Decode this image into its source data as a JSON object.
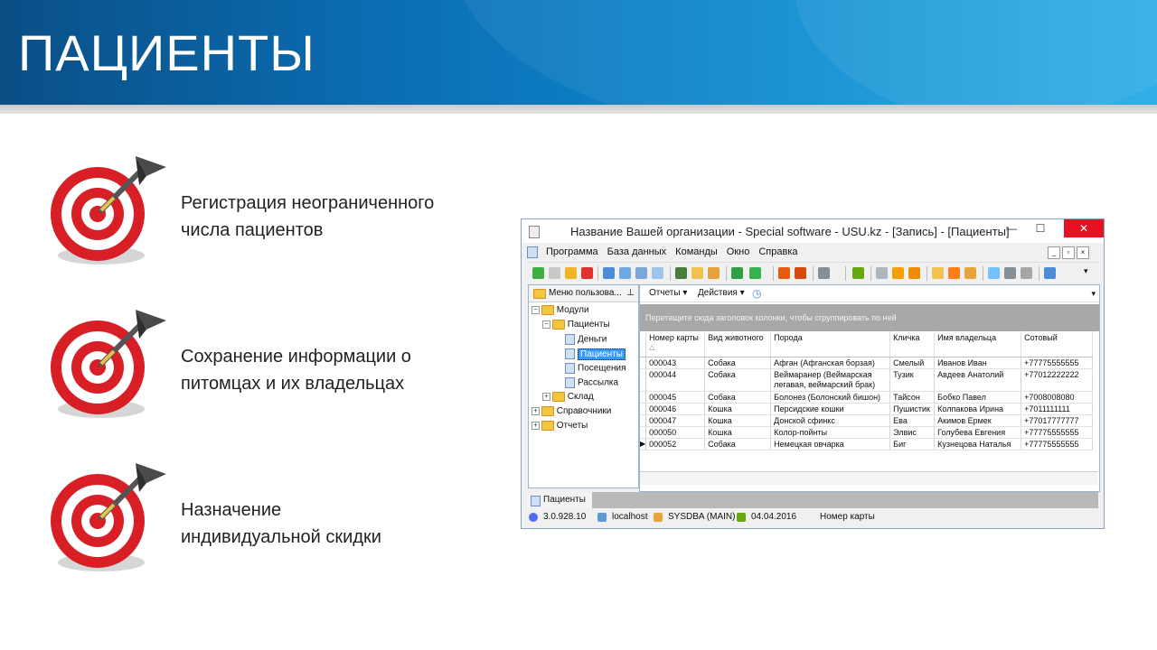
{
  "slide": {
    "title": "ПАЦИЕНТЫ",
    "features": [
      {
        "line1": "Регистрация неограниченного",
        "line2": "числа пациентов",
        "icon": "target-dart-icon"
      },
      {
        "line1": "Сохранение информации о",
        "line2": "питомцах и их владельцах",
        "icon": "target-dart-icon"
      },
      {
        "line1": "Назначение",
        "line2": "индивидуальной скидки",
        "icon": "target-dart-icon"
      }
    ]
  },
  "window": {
    "title": "Название Вашей организации - Special software - USU.kz - [Запись] - [Пациенты]",
    "controls": {
      "minimize": "—",
      "maximize": "☐",
      "close": "✕"
    },
    "menu": [
      "Программа",
      "База данных",
      "Команды",
      "Окно",
      "Справка"
    ],
    "sidebar": {
      "header": "Меню пользова...",
      "tree": {
        "root": "Модули",
        "patients": "Пациенты",
        "money": "Деньги",
        "patients_child": "Пациенты",
        "visits": "Посещения",
        "mailing": "Рассылка",
        "warehouse": "Склад",
        "directories": "Справочники",
        "reports": "Отчеты"
      }
    },
    "grid_toolbar": {
      "reports": "Отчеты",
      "actions": "Действия"
    },
    "group_hint": "Перетащите сюда заголовок колонки, чтобы сгруппировать по ней",
    "columns": [
      "Номер карты",
      "Вид животного",
      "Порода",
      "Кличка",
      "Имя владельца",
      "Сотовый"
    ],
    "rows": [
      {
        "num": "000043",
        "species": "Собака",
        "breed": "Афган (Афганская борзая)",
        "name": "Смелый",
        "owner": "Иванов Иван",
        "phone": "+77775555555"
      },
      {
        "num": "000044",
        "species": "Собака",
        "breed": "Веймаранер (Веймарская легавая, веймарский брак)",
        "name": "Тузик",
        "owner": "Авдеев Анатолий",
        "phone": "+77012222222"
      },
      {
        "num": "000045",
        "species": "Собака",
        "breed": "Болонез (Болонский бишон)",
        "name": "Тайсон",
        "owner": "Бобко Павел",
        "phone": "+7008008080"
      },
      {
        "num": "000046",
        "species": "Кошка",
        "breed": "Персидские кошки",
        "name": "Пушистик",
        "owner": "Колпакова Ирина",
        "phone": "+7011111111"
      },
      {
        "num": "000047",
        "species": "Кошка",
        "breed": "Донской сфинкс",
        "name": "Ева",
        "owner": "Акимов Ермек",
        "phone": "+77017777777"
      },
      {
        "num": "000050",
        "species": "Кошка",
        "breed": "Колор-пойнты",
        "name": "Элвис",
        "owner": "Голубева Евгения",
        "phone": "+77775555555"
      },
      {
        "num": "000052",
        "species": "Собака",
        "breed": "Немецкая овчарка",
        "name": "Биг",
        "owner": "Кузнецова Наталья",
        "phone": "+77775555555"
      }
    ],
    "tab": "Пациенты",
    "status": {
      "version": "3.0.928.10",
      "host": "localhost",
      "user": "SYSDBA (MAIN)",
      "date": "04.04.2016",
      "field": "Номер карты"
    }
  }
}
